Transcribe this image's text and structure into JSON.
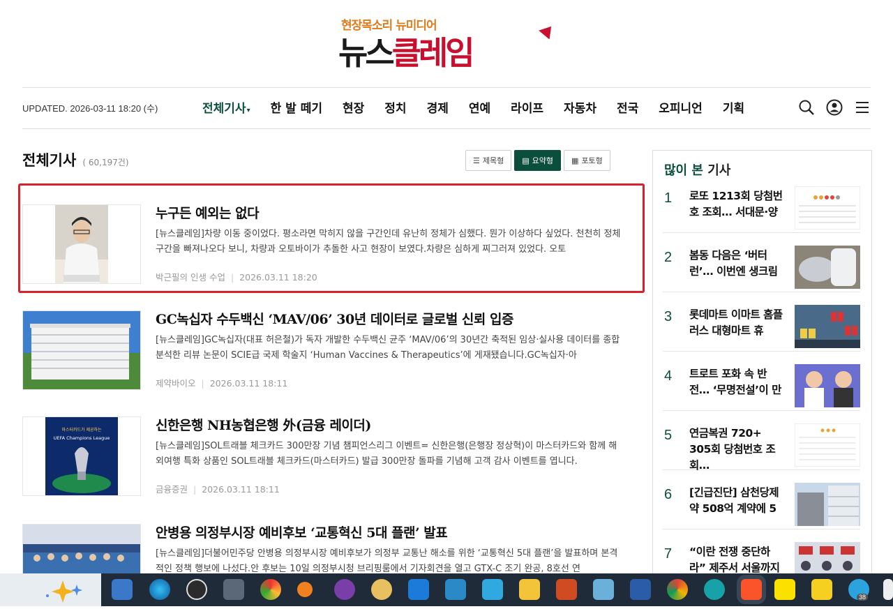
{
  "header": {
    "tagline": "현장목소리 뉴미디어",
    "brand_part1": "뉴스",
    "brand_part2": "클레임"
  },
  "nav": {
    "updated": "UPDATED. 2026-03-11 18:20 (수)",
    "menu": [
      "전체기사",
      "한 발 떼기",
      "현장",
      "정치",
      "경제",
      "연예",
      "라이프",
      "자동차",
      "전국",
      "오피니언",
      "기획"
    ],
    "icons": [
      "search-icon",
      "user-icon",
      "menu-icon"
    ]
  },
  "section": {
    "title": "전체기사",
    "count": "( 60,197건)",
    "views": [
      "제목형",
      "요약형",
      "포토형"
    ]
  },
  "articles": [
    {
      "title": "누구든 예외는 없다",
      "summary": "[뉴스클레임]차량 이동 중이었다. 평소라면 막히지 않을 구간인데 유난히 정체가 심했다. 뭔가 이상하다 싶었다. 천천히 정체 구간을 빠져나오다 보니, 차량과 오토바이가 추돌한 사고 현장이 보였다.차량은 심하게 찌그러져 있었다. 오토",
      "category": "박근필의 인생 수업",
      "date": "2026.03.11 18:20"
    },
    {
      "title": "GC녹십자 수두백신 ‘MAV/06’ 30년 데이터로 글로벌 신뢰 입증",
      "summary": "[뉴스클레임]GC녹십자(대표 허은철)가 독자 개발한 수두백신 균주 ‘MAV/06’의 30년간 축적된 임상·실사용 데이터를 종합 분석한 리뷰 논문이 SCIE급 국제 학술지 ‘Human Vaccines & Therapeutics’에 게재됐습니다.GC녹십자·아",
      "category": "제약바이오",
      "date": "2026.03.11 18:11"
    },
    {
      "title": "신한은행 NH농협은행 外(금융 레이더)",
      "summary": "[뉴스클레임]SOL트래블 체크카드 300만장 기념 챔피언스리그 이벤트= 신한은행(은행장 정상혁)이 마스터카드와 함께 해외여행 특화 상품인 SOL트래블 체크카드(마스터카드) 발급 300만장 돌파를 기념해 고객 감사 이벤트를 엽니다.",
      "category": "금융증권",
      "date": "2026.03.11 18:11"
    },
    {
      "title": "안병용 의정부시장 예비후보 ‘교통혁신 5대 플랜’ 발표",
      "summary": "[뉴스클레임]더불어민주당 안병용 의정부시장 예비후보가 의정부 교통난 해소를 위한 ‘교통혁신 5대 플랜’을 발표하며 본격적인 정책 행보에 나섰다.안 후보는 10일 의정부시청 브리핑룸에서 기자회견을 열고 GTX-C 조기 완공, 8호선 연",
      "category": "",
      "date": ""
    }
  ],
  "thumb_captions": {
    "a3_line1": "마스터카드가 제공하는",
    "a3_line2": "UEFA Champions League"
  },
  "sidebar": {
    "title_accent": "많이 본",
    "title_rest": " 기사",
    "items": [
      {
        "num": "1",
        "text": "로또 1213회 당첨번호 조회… 서대문·양"
      },
      {
        "num": "2",
        "text": "봄동 다음은 ‘버터런’… 이번엔 생크림"
      },
      {
        "num": "3",
        "text": "롯데마트 이마트 홈플러스 대형마트 휴"
      },
      {
        "num": "4",
        "text": "트로트 포화 속 반전… ‘무명전설’이 만"
      },
      {
        "num": "5",
        "text": "연금복권 720+ 305회 당첨번호 조회…"
      },
      {
        "num": "6",
        "text": "[긴급진단] 삼천당제약 508억 계약에 5"
      },
      {
        "num": "7",
        "text": "“이란 전쟁 중단하라” 제주서 서울까지 시"
      }
    ]
  },
  "taskbar": {
    "badge": "38",
    "icons": [
      "copilot-icon",
      "explorer-icon",
      "edge-icon",
      "obs-icon",
      "calculator-icon",
      "chrome-canary-icon",
      "search-app-icon",
      "github-icon",
      "paint-icon",
      "uplay-icon",
      "hangul-icon",
      "vscode-icon",
      "folder-icon",
      "powerpoint-icon",
      "notepad-icon",
      "word-icon",
      "chrome-icon",
      "app-icon",
      "brave-icon",
      "kakaotalk-icon",
      "pdf-icon",
      "telegram-icon",
      "app2-icon"
    ],
    "colors": {
      "accent": "#0c4e3c",
      "highlight": "#d8202d",
      "taskbar": "#1f2b38"
    }
  }
}
